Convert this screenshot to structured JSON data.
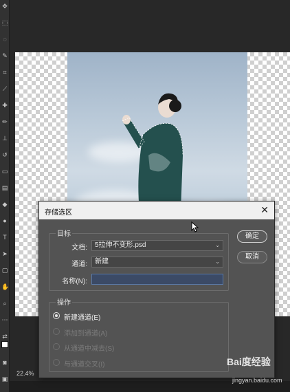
{
  "status": {
    "zoom": "22.4%"
  },
  "dialog": {
    "title": "存储选区",
    "close_icon": "close-icon",
    "target_group": {
      "label": "目标",
      "document_label": "文档:",
      "document_value": "5拉伸不变形.psd",
      "channel_label": "通道:",
      "channel_value": "新建",
      "name_label": "名称(N):",
      "name_value": ""
    },
    "operation_group": {
      "label": "操作",
      "options": [
        {
          "label": "新建通道(E)",
          "selected": true,
          "enabled": true
        },
        {
          "label": "添加到通道(A)",
          "selected": false,
          "enabled": false
        },
        {
          "label": "从通道中减去(S)",
          "selected": false,
          "enabled": false
        },
        {
          "label": "与通道交叉(I)",
          "selected": false,
          "enabled": false
        }
      ]
    },
    "ok_label": "确定",
    "cancel_label": "取消"
  },
  "watermark": {
    "logo": "Bai度经验",
    "url": "jingyan.baidu.com"
  },
  "colors": {
    "dialog_bg": "#535353",
    "app_bg": "#282828",
    "name_field": "#3b4a66"
  }
}
